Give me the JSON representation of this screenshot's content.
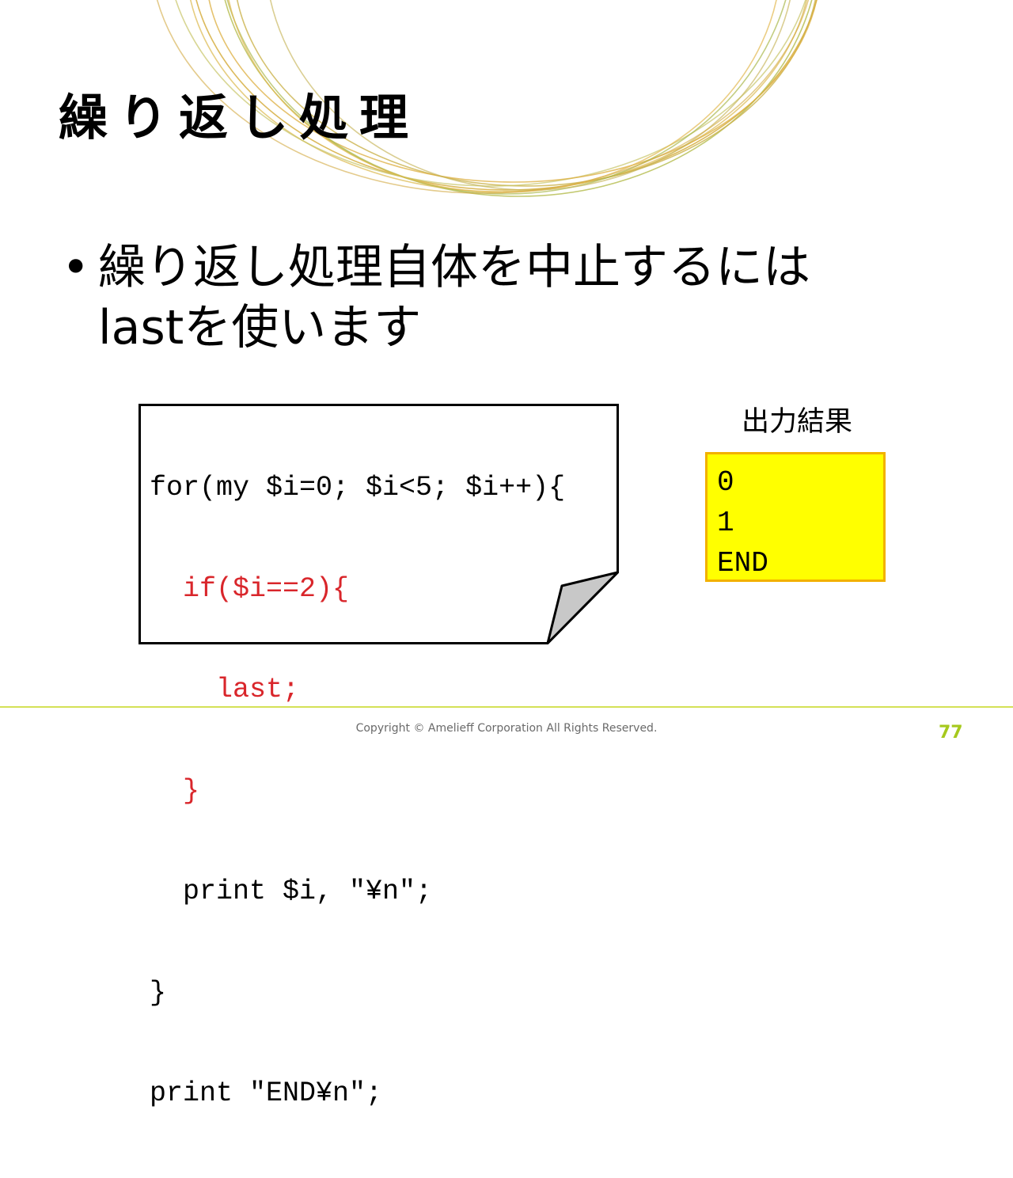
{
  "slide": {
    "title": "繰り返し処理",
    "bullet": {
      "line1": "繰り返し処理自体を中止するには",
      "line2": "lastを使います"
    }
  },
  "code": {
    "lines": [
      {
        "text": "for(my $i=0; $i<5; $i++){",
        "highlight": false
      },
      {
        "text": "  if($i==2){",
        "highlight": true
      },
      {
        "text": "    last;",
        "highlight": true
      },
      {
        "text": "  }",
        "highlight": true
      },
      {
        "text": "  print $i, \"¥n\";",
        "highlight": false
      },
      {
        "text": "}",
        "highlight": false
      },
      {
        "text": "print \"END¥n\";",
        "highlight": false
      }
    ]
  },
  "output": {
    "label": "出力結果",
    "lines": [
      "0",
      "1",
      "END"
    ]
  },
  "footer": {
    "copyright": "Copyright © Amelieff Corporation All Rights Reserved.",
    "page_number": "77"
  },
  "colors": {
    "highlight_code": "#d9262b",
    "output_background": "#ffff00",
    "output_border": "#f2b100",
    "accent_green": "#a6c91d",
    "ring_gold": "#d8b24a",
    "ring_olive": "#b9bf57"
  }
}
